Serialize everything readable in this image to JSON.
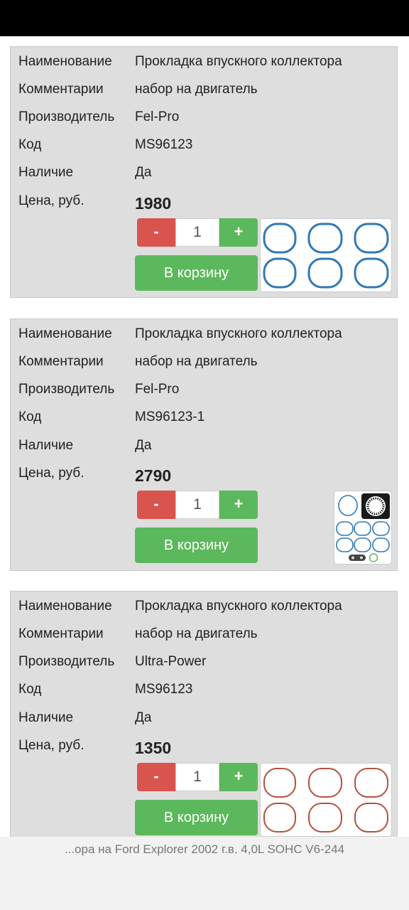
{
  "labels": {
    "name": "Наименование",
    "comment": "Комментарии",
    "maker": "Производитель",
    "code": "Код",
    "stock": "Наличие",
    "price": "Цена, руб."
  },
  "controls": {
    "minus": "-",
    "plus": "+",
    "cart": "В корзину"
  },
  "products": [
    {
      "name": "Прокладка впускного коллектора",
      "comment": "набор на двигатель",
      "maker": "Fel-Pro",
      "code": "MS96123",
      "stock": "Да",
      "price": "1980",
      "qty": "1",
      "gasket_color": "#2f79b5"
    },
    {
      "name": "Прокладка впускного коллектора",
      "comment": "набор на двигатель",
      "maker": "Fel-Pro",
      "code": "MS96123-1",
      "stock": "Да",
      "price": "2790",
      "qty": "1",
      "gasket_color": "#2f79b5"
    },
    {
      "name": "Прокладка впускного коллектора",
      "comment": "набор на двигатель",
      "maker": "Ultra-Power",
      "code": "MS96123",
      "stock": "Да",
      "price": "1350",
      "qty": "1",
      "gasket_color": "#b5503d"
    }
  ],
  "footer": {
    "caption": "...ора на Ford Explorer 2002 г.в. 4,0L SOHC V6-244"
  }
}
